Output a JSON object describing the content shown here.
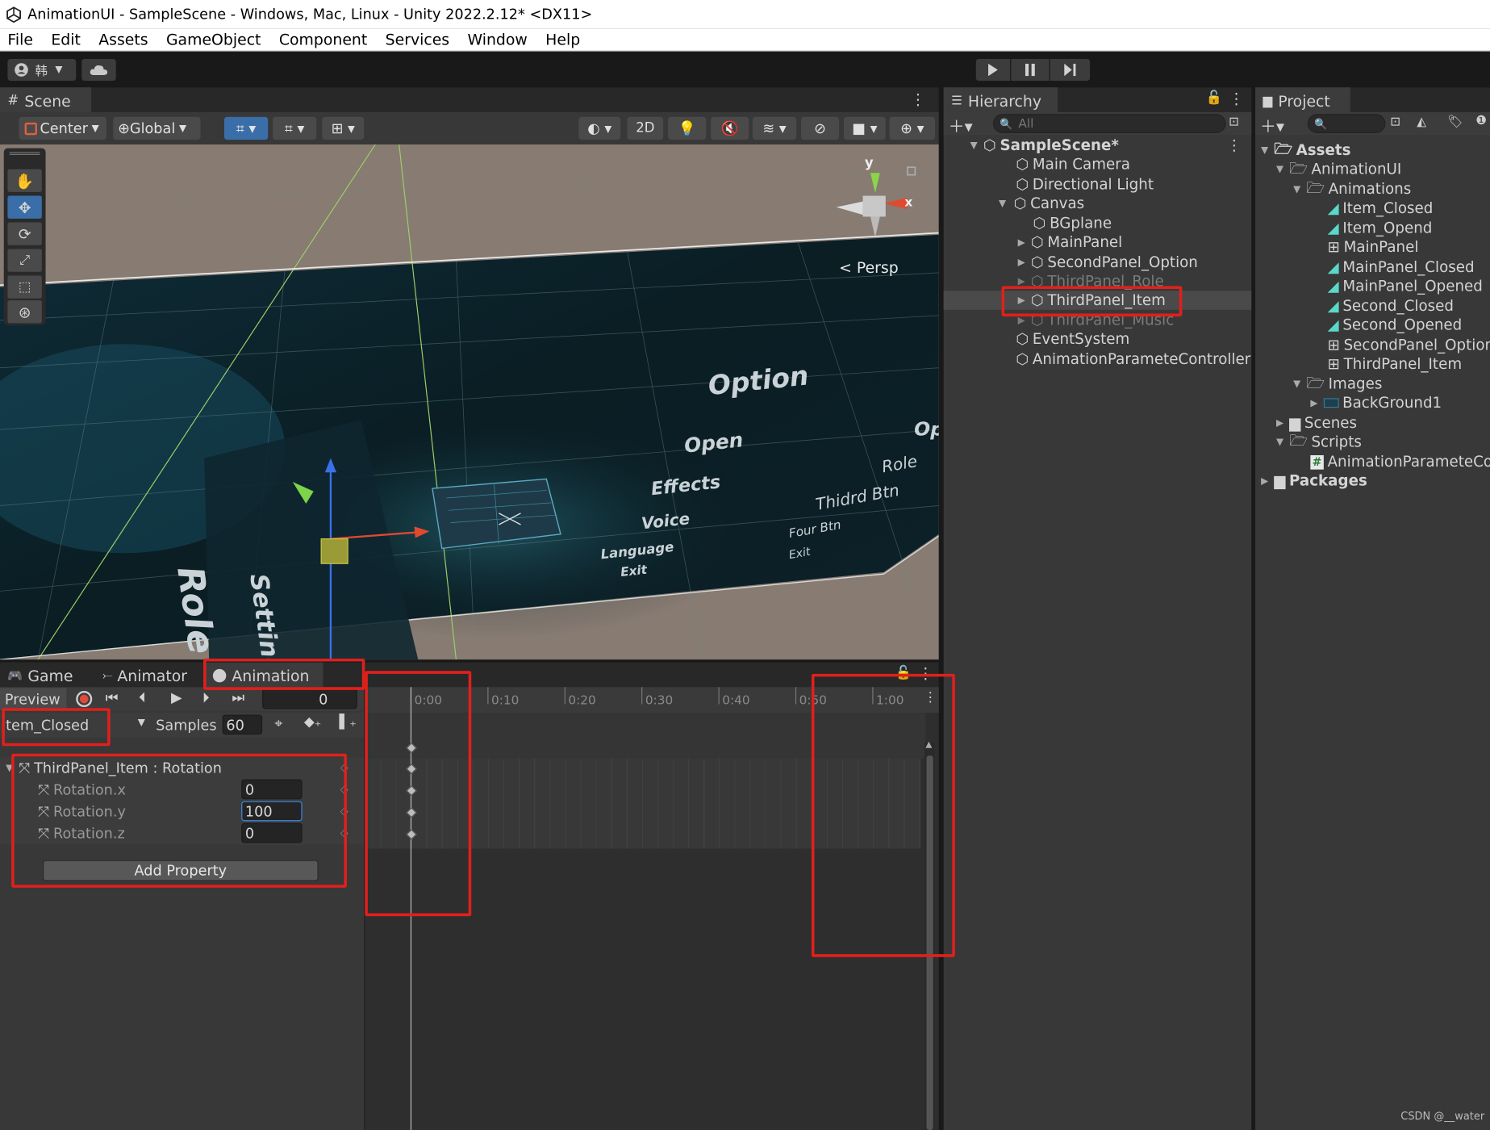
{
  "window": {
    "title": "AnimationUI - SampleScene - Windows, Mac, Linux - Unity 2022.2.12* <DX11>"
  },
  "menu": [
    "File",
    "Edit",
    "Assets",
    "GameObject",
    "Component",
    "Services",
    "Window",
    "Help"
  ],
  "toolbar": {
    "account_label": "韩"
  },
  "scene": {
    "tab": "Scene",
    "pivot": "Center",
    "space": "Global",
    "mode2d": "2D",
    "persp": "< Persp",
    "gizmo_y": "y",
    "gizmo_x": "x",
    "texts": [
      "Option",
      "Open",
      "Effects",
      "Voice",
      "Language",
      "Exit",
      "Role",
      "Thidrd Btn",
      "Four Btn",
      "Exit",
      "Role",
      "Setting",
      "Op"
    ]
  },
  "hierarchy": {
    "tab": "Hierarchy",
    "search_placeholder": "All",
    "items": [
      "SampleScene*",
      "Main Camera",
      "Directional Light",
      "Canvas",
      "BGplane",
      "MainPanel",
      "SecondPanel_Option",
      "ThirdPanel_Role",
      "ThirdPanel_Item",
      "ThirdPanel_Music",
      "EventSystem",
      "AnimationParameteController"
    ]
  },
  "project": {
    "tab": "Project",
    "items": [
      "Assets",
      "AnimationUI",
      "Animations",
      "Item_Closed",
      "Item_Opend",
      "MainPanel",
      "MainPanel_Closed",
      "MainPanel_Opened",
      "Second_Closed",
      "Second_Opened",
      "SecondPanel_Option",
      "ThirdPanel_Item",
      "Images",
      "BackGround1",
      "Scenes",
      "Scripts",
      "AnimationParameteCon",
      "Packages"
    ]
  },
  "animation": {
    "tabs": [
      "Game",
      "Animator",
      "Animation"
    ],
    "preview": "Preview",
    "frame": "0",
    "clip": "tem_Closed",
    "samples_label": "Samples",
    "samples": "60",
    "property_group": "ThirdPanel_Item : Rotation",
    "properties": [
      {
        "name": "Rotation.x",
        "value": "0"
      },
      {
        "name": "Rotation.y",
        "value": "100"
      },
      {
        "name": "Rotation.z",
        "value": "0"
      }
    ],
    "add_property": "Add Property",
    "timeline_labels": [
      "0:00",
      "0:10",
      "0:20",
      "0:30",
      "0:40",
      "0:50",
      "1:00"
    ]
  },
  "watermark": "CSDN @__water",
  "colors": {
    "highlight": "#e0201c",
    "panel": "#383838",
    "accent": "#3a6ea8"
  }
}
